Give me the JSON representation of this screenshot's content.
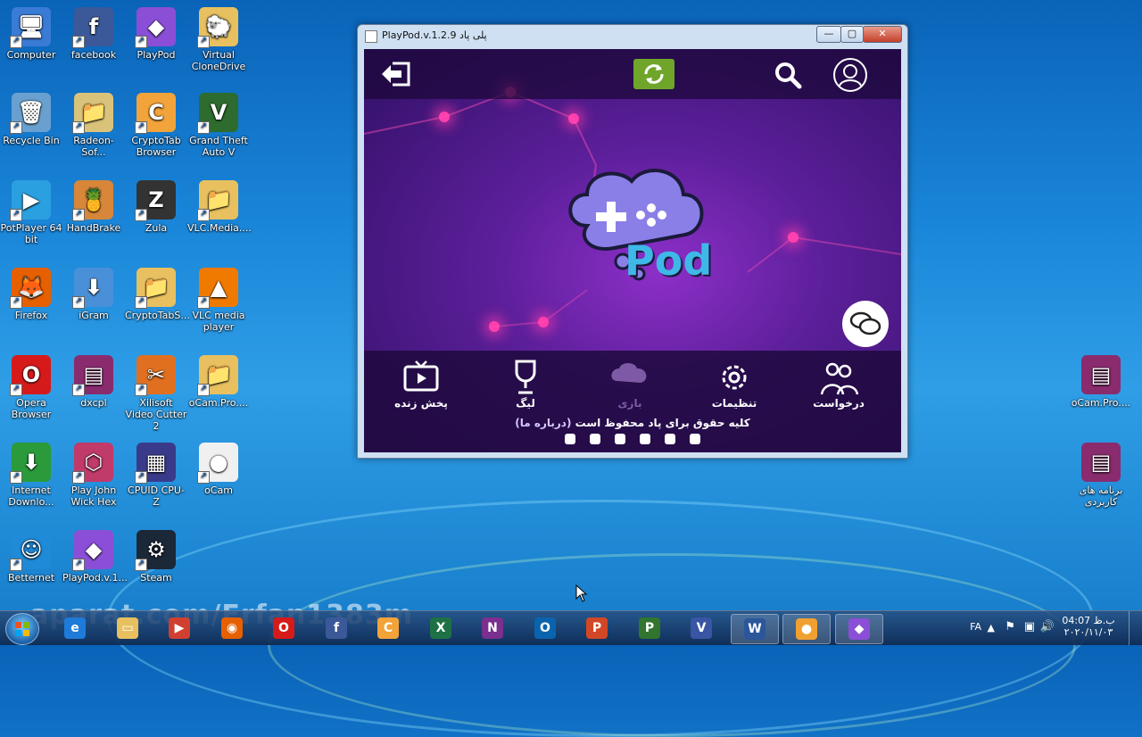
{
  "desktop_icons": [
    {
      "label": "Computer",
      "color": "#3a7bd5",
      "glyph": "🖥"
    },
    {
      "label": "facebook",
      "color": "#3b5998",
      "glyph": "f"
    },
    {
      "label": "PlayPod",
      "color": "#8a4fd6",
      "glyph": "◆"
    },
    {
      "label": "Virtual CloneDrive",
      "color": "#e8c060",
      "glyph": "🐑"
    },
    {
      "label": "Recycle Bin",
      "color": "#6aa0d0",
      "glyph": "🗑"
    },
    {
      "label": "Radeon-Sof...",
      "color": "#d9c27a",
      "glyph": "📁"
    },
    {
      "label": "CryptoTab Browser",
      "color": "#f2a33a",
      "glyph": "C"
    },
    {
      "label": "Grand Theft Auto V",
      "color": "#2e6b2e",
      "glyph": "V"
    },
    {
      "label": "PotPlayer 64 bit",
      "color": "#2aa0e0",
      "glyph": "▶"
    },
    {
      "label": "HandBrake",
      "color": "#d8863a",
      "glyph": "🍍"
    },
    {
      "label": "Zula",
      "color": "#333333",
      "glyph": "Z"
    },
    {
      "label": "VLC.Media....",
      "color": "#e8c060",
      "glyph": "📁"
    },
    {
      "label": "Firefox",
      "color": "#e66000",
      "glyph": "🦊"
    },
    {
      "label": "iGram",
      "color": "#4a90d9",
      "glyph": "⬇"
    },
    {
      "label": "CryptoTabS...",
      "color": "#e8c060",
      "glyph": "📁"
    },
    {
      "label": "VLC media player",
      "color": "#f07a00",
      "glyph": "▲"
    },
    {
      "label": "Opera Browser",
      "color": "#d61a1a",
      "glyph": "O"
    },
    {
      "label": "dxcpl",
      "color": "#8a2b6e",
      "glyph": "▤"
    },
    {
      "label": "Xilisoft Video Cutter 2",
      "color": "#e07020",
      "glyph": "✂"
    },
    {
      "label": "oCam.Pro....",
      "color": "#e8c060",
      "glyph": "📁"
    },
    {
      "label": "Internet Downlo...",
      "color": "#2a9a3a",
      "glyph": "⬇"
    },
    {
      "label": "Play John Wick Hex",
      "color": "#c03a6a",
      "glyph": "⬡"
    },
    {
      "label": "CPUID CPU-Z",
      "color": "#3a3a8a",
      "glyph": "▦"
    },
    {
      "label": "oCam",
      "color": "#f0f0f0",
      "glyph": "●"
    },
    {
      "label": "Betternet",
      "color": "#1f8ad8",
      "glyph": "☺"
    },
    {
      "label": "PlayPod.v.1...",
      "color": "#8a4fd6",
      "glyph": "◆"
    },
    {
      "label": "Steam",
      "color": "#1b2838",
      "glyph": "⚙"
    }
  ],
  "right_icons": [
    {
      "label": "oCam.Pro....",
      "color": "#8a2b6e",
      "glyph": "▤"
    },
    {
      "label": "برنامه های کاربردی",
      "color": "#8a2b6e",
      "glyph": "▤"
    }
  ],
  "window": {
    "title": "PlayPod.v.1.2.9  پلی پاد",
    "minimize": "—",
    "maximize": "▢",
    "close": "✕",
    "nav": [
      {
        "label": "پخش زنده",
        "icon": "tv-icon",
        "active": true
      },
      {
        "label": "لیگ",
        "icon": "trophy-icon",
        "active": true
      },
      {
        "label": "بازی",
        "icon": "pod-icon",
        "active": false
      },
      {
        "label": "تنظیمات",
        "icon": "gear-icon",
        "active": true
      },
      {
        "label": "درخواست",
        "icon": "people-icon",
        "active": true
      }
    ],
    "footer_text": "کلیه حقوق برای پاد محفوظ است",
    "footer_link": "(درباره ما)",
    "logo_text": "Pod"
  },
  "watermark": "aparat.com/Erfan1383m",
  "taskbar": {
    "apps": [
      {
        "name": "ie",
        "color": "#1e7bd8",
        "glyph": "e"
      },
      {
        "name": "explorer",
        "color": "#e8c060",
        "glyph": "▭"
      },
      {
        "name": "media",
        "color": "#d04030",
        "glyph": "▶"
      },
      {
        "name": "firefox",
        "color": "#e66000",
        "glyph": "◉"
      },
      {
        "name": "opera",
        "color": "#d61a1a",
        "glyph": "O"
      },
      {
        "name": "facebook",
        "color": "#3b5998",
        "glyph": "f"
      },
      {
        "name": "cryptotab",
        "color": "#f2a33a",
        "glyph": "C"
      },
      {
        "name": "excel",
        "color": "#1e7145",
        "glyph": "X"
      },
      {
        "name": "onenote",
        "color": "#7b2f8f",
        "glyph": "N"
      },
      {
        "name": "outlook",
        "color": "#0a64ad",
        "glyph": "O"
      },
      {
        "name": "powerpoint",
        "color": "#d24726",
        "glyph": "P"
      },
      {
        "name": "project",
        "color": "#31752f",
        "glyph": "P"
      },
      {
        "name": "visio",
        "color": "#3955a3",
        "glyph": "V"
      },
      {
        "name": "word",
        "color": "#2b579a",
        "glyph": "W"
      },
      {
        "name": "ocam",
        "color": "#f0a030",
        "glyph": "●"
      },
      {
        "name": "playpod",
        "color": "#8a4fd6",
        "glyph": "◆"
      }
    ],
    "lang": "FA",
    "time": "04:07 ب.ظ",
    "date": "۲۰۲۰/۱۱/۰۳"
  }
}
